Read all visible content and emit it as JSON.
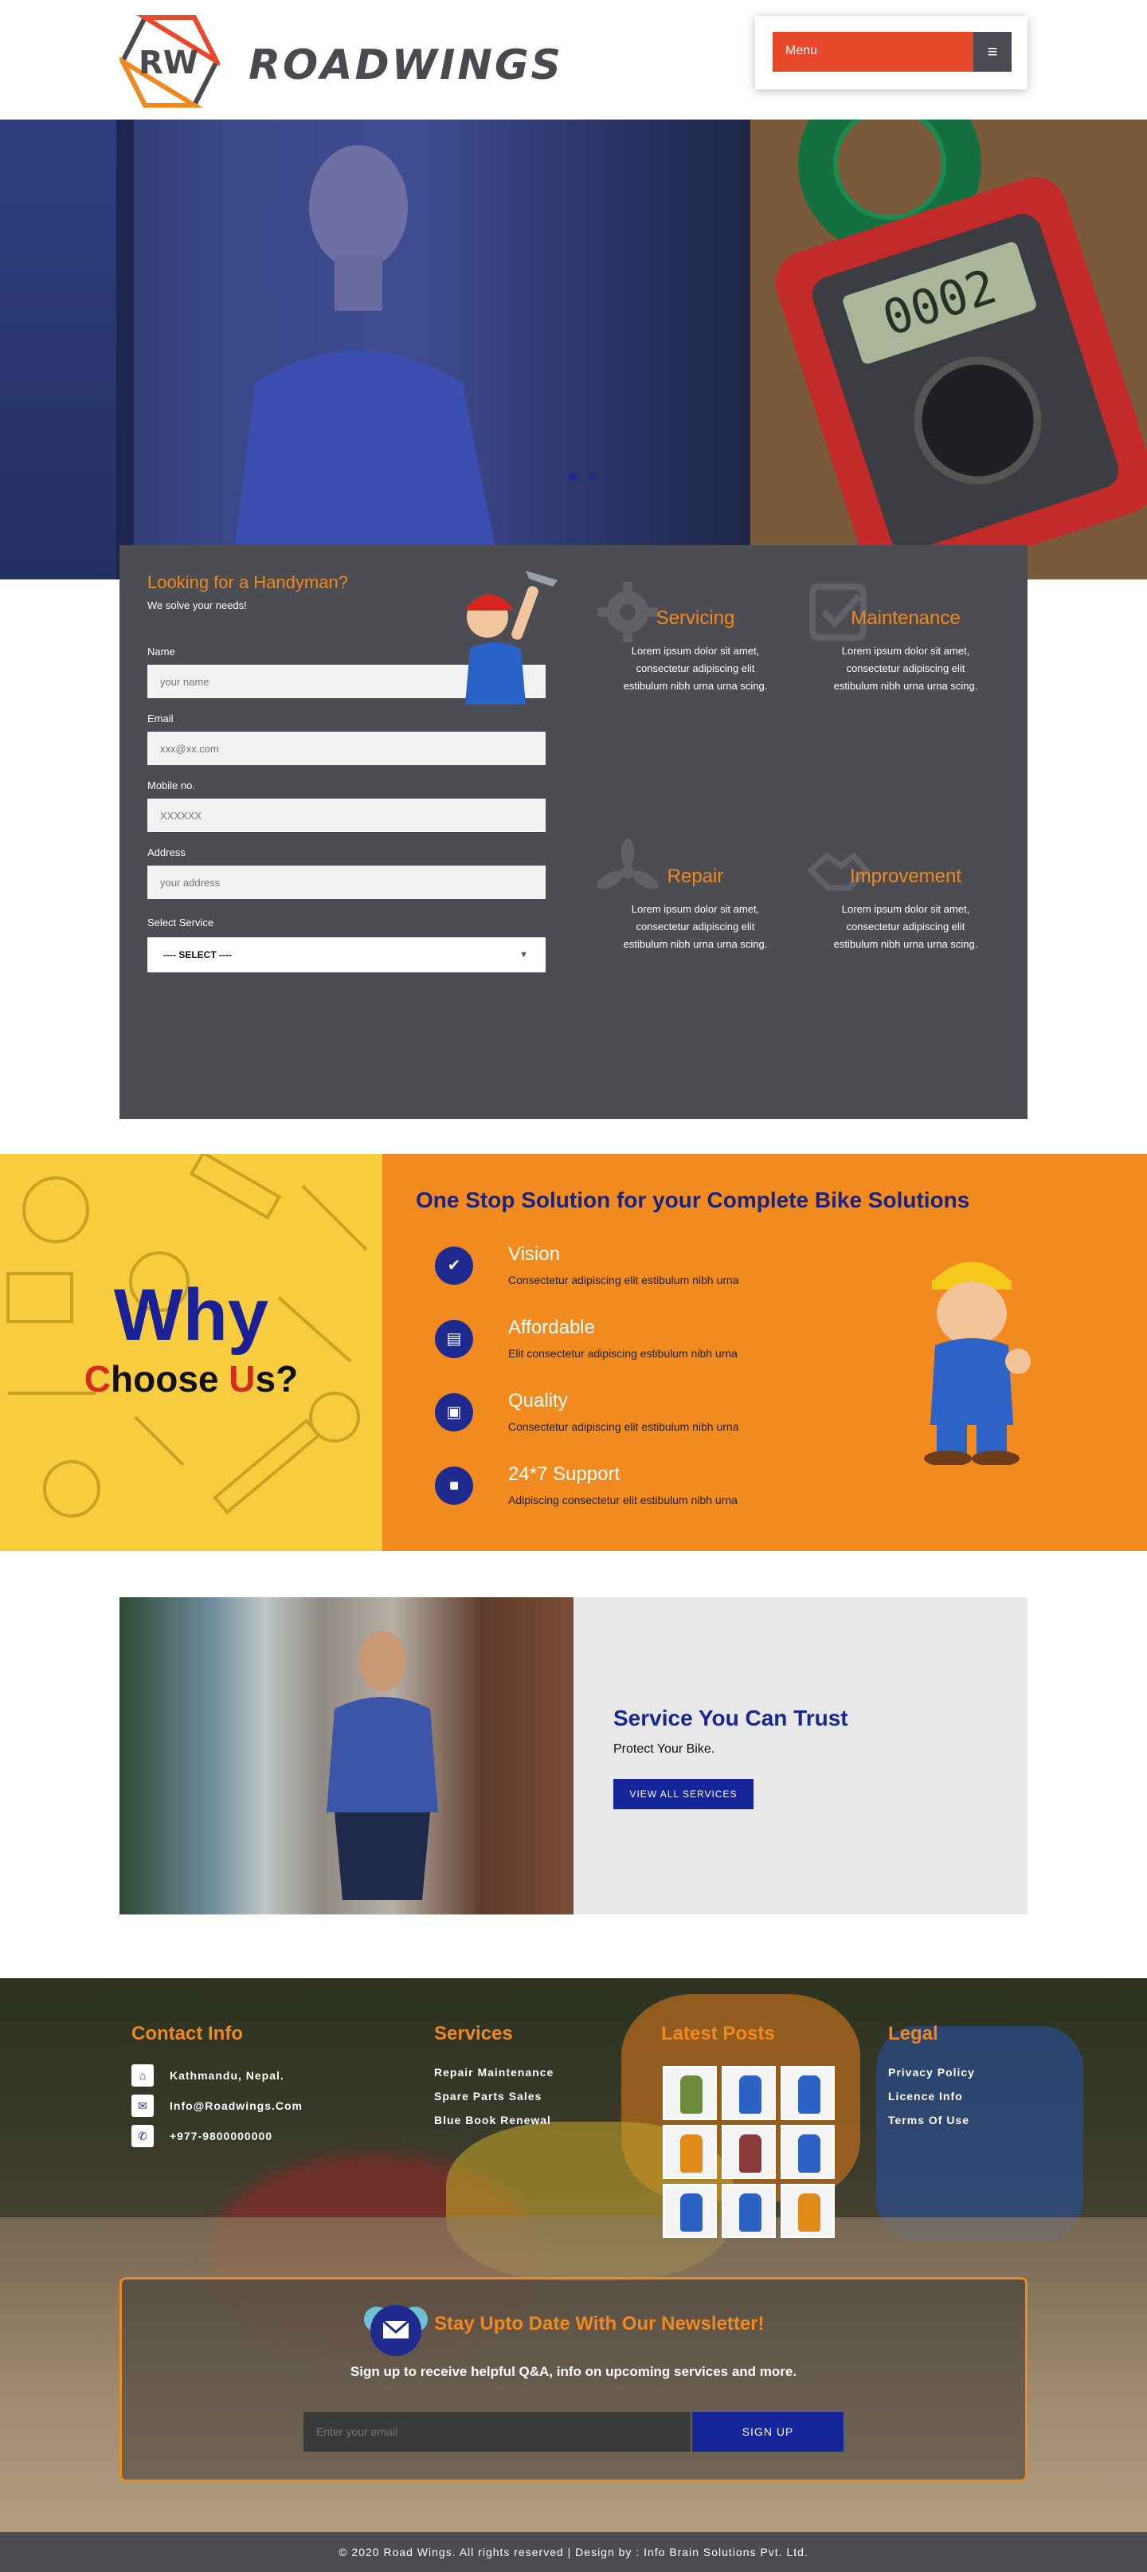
{
  "brand": {
    "logo_initials": "RW",
    "logo_word": "ROADWINGS",
    "accent_orange": "#e8492a",
    "accent_amber": "#f0891f",
    "accent_navy": "#16269a"
  },
  "header": {
    "menu_label": "Menu",
    "menu_icon": "hamburger-icon"
  },
  "hero": {
    "slide_count": 2,
    "active_slide": 1
  },
  "form": {
    "title": "Looking for a Handyman?",
    "subtitle": "We solve your needs!",
    "fields": [
      {
        "label": "Name",
        "placeholder": "your name"
      },
      {
        "label": "Email",
        "placeholder": "xxx@xx.com"
      },
      {
        "label": "Mobile no.",
        "placeholder": "XXXXXX"
      },
      {
        "label": "Address",
        "placeholder": "your address"
      }
    ],
    "service_label": "Select Service",
    "service_selected": "---- SELECT ----"
  },
  "services": [
    {
      "title": "Servicing",
      "text": "Lorem ipsum dolor sit amet, consectetur adipiscing elit estibulum nibh urna urna scing.",
      "icon": "gear-icon"
    },
    {
      "title": "Maintenance",
      "text": "Lorem ipsum dolor sit amet, consectetur adipiscing elit estibulum nibh urna urna scing.",
      "icon": "checkbox-icon"
    },
    {
      "title": "Repair",
      "text": "Lorem ipsum dolor sit amet, consectetur adipiscing elit estibulum nibh urna urna scing.",
      "icon": "fan-icon"
    },
    {
      "title": "Improvement",
      "text": "Lorem ipsum dolor sit amet, consectetur adipiscing elit estibulum nibh urna urna scing.",
      "icon": "handshake-icon"
    }
  ],
  "why": {
    "word": "Why",
    "choose_c": "C",
    "choose_mid": "hoose ",
    "choose_u": "U",
    "choose_end": "s?",
    "heading": "One Stop Solution for your Complete Bike Solutions",
    "features": [
      {
        "title": "Vision",
        "text": "Consectetur adipiscing elit estibulum nibh urna",
        "icon": "check-icon"
      },
      {
        "title": "Affordable",
        "text": "Elit consectetur adipiscing estibulum nibh urna",
        "icon": "book-icon"
      },
      {
        "title": "Quality",
        "text": "Consectetur adipiscing elit estibulum nibh urna",
        "icon": "image-icon"
      },
      {
        "title": "24*7 Support",
        "text": "Adipiscing consectetur elit estibulum nibh urna",
        "icon": "briefcase-icon"
      }
    ]
  },
  "trust": {
    "title": "Service You Can Trust",
    "subtitle": "Protect Your Bike.",
    "button": "VIEW ALL SERVICES"
  },
  "footer": {
    "contact_title": "Contact Info",
    "contact": [
      {
        "icon": "home-icon",
        "text": "Kathmandu, Nepal."
      },
      {
        "icon": "mail-icon",
        "text": "Info@Roadwings.Com"
      },
      {
        "icon": "phone-icon",
        "text": "+977-9800000000"
      }
    ],
    "services_title": "Services",
    "services": [
      "Repair Maintenance",
      "Spare Parts Sales",
      "Blue Book Renewal"
    ],
    "posts_title": "Latest Posts",
    "legal_title": "Legal",
    "legal": [
      "Privacy Policy",
      "Licence Info",
      "Terms Of Use"
    ]
  },
  "newsletter": {
    "title": "Stay Upto Date With Our Newsletter!",
    "subtitle": "Sign up to receive helpful Q&A, info on upcoming services and more.",
    "placeholder": "Enter your email",
    "button": "SIGN UP"
  },
  "copyright": "© 2020 Road Wings. All rights reserved | Design by : Info Brain Solutions Pvt. Ltd."
}
